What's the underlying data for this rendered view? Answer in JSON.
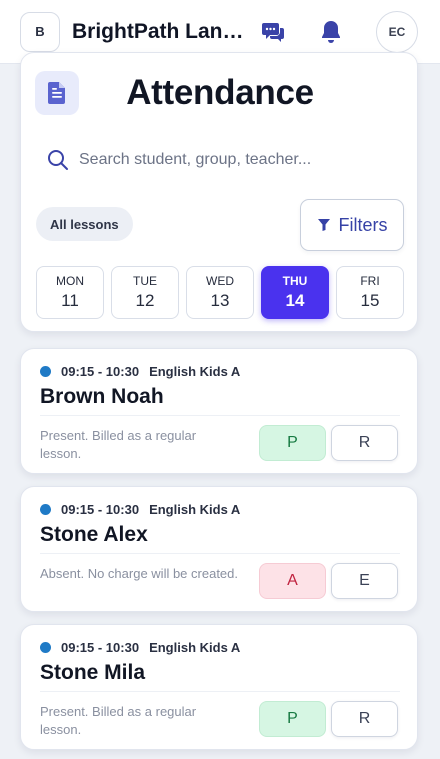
{
  "topbar": {
    "logo": "B",
    "brand": "BrightPath Lang...",
    "avatar": "EC",
    "icons": [
      "chat-bubbles-icon",
      "bell-icon"
    ]
  },
  "header": {
    "title": "Attendance",
    "search_placeholder": "Search student, group, teacher...",
    "all_lessons_label": "All lessons",
    "filters_label": "Filters"
  },
  "days": [
    {
      "name": "MON",
      "num": "11"
    },
    {
      "name": "TUE",
      "num": "12"
    },
    {
      "name": "WED",
      "num": "13"
    },
    {
      "name": "THU",
      "num": "14",
      "active": true
    },
    {
      "name": "FRI",
      "num": "15"
    }
  ],
  "lessons": [
    {
      "time": "09:15 - 10:30",
      "group": "English Kids A",
      "student": "Brown Noah",
      "note": "Present. Billed as a regular lesson.",
      "mark": "P",
      "secondary": "R",
      "status": "present"
    },
    {
      "time": "09:15 - 10:30",
      "group": "English Kids A",
      "student": "Stone Alex",
      "note": "Absent. No charge will be created.",
      "mark": "A",
      "secondary": "E",
      "status": "absent"
    },
    {
      "time": "09:15 - 10:30",
      "group": "English Kids A",
      "student": "Stone Mila",
      "note": "Present. Billed as a regular lesson.",
      "mark": "P",
      "secondary": "R",
      "status": "present"
    }
  ],
  "colors": {
    "accent": "#4a32ee",
    "dot": "#1f7ac6",
    "present_bg": "#d6f6e3",
    "absent_bg": "#fde2e7"
  }
}
